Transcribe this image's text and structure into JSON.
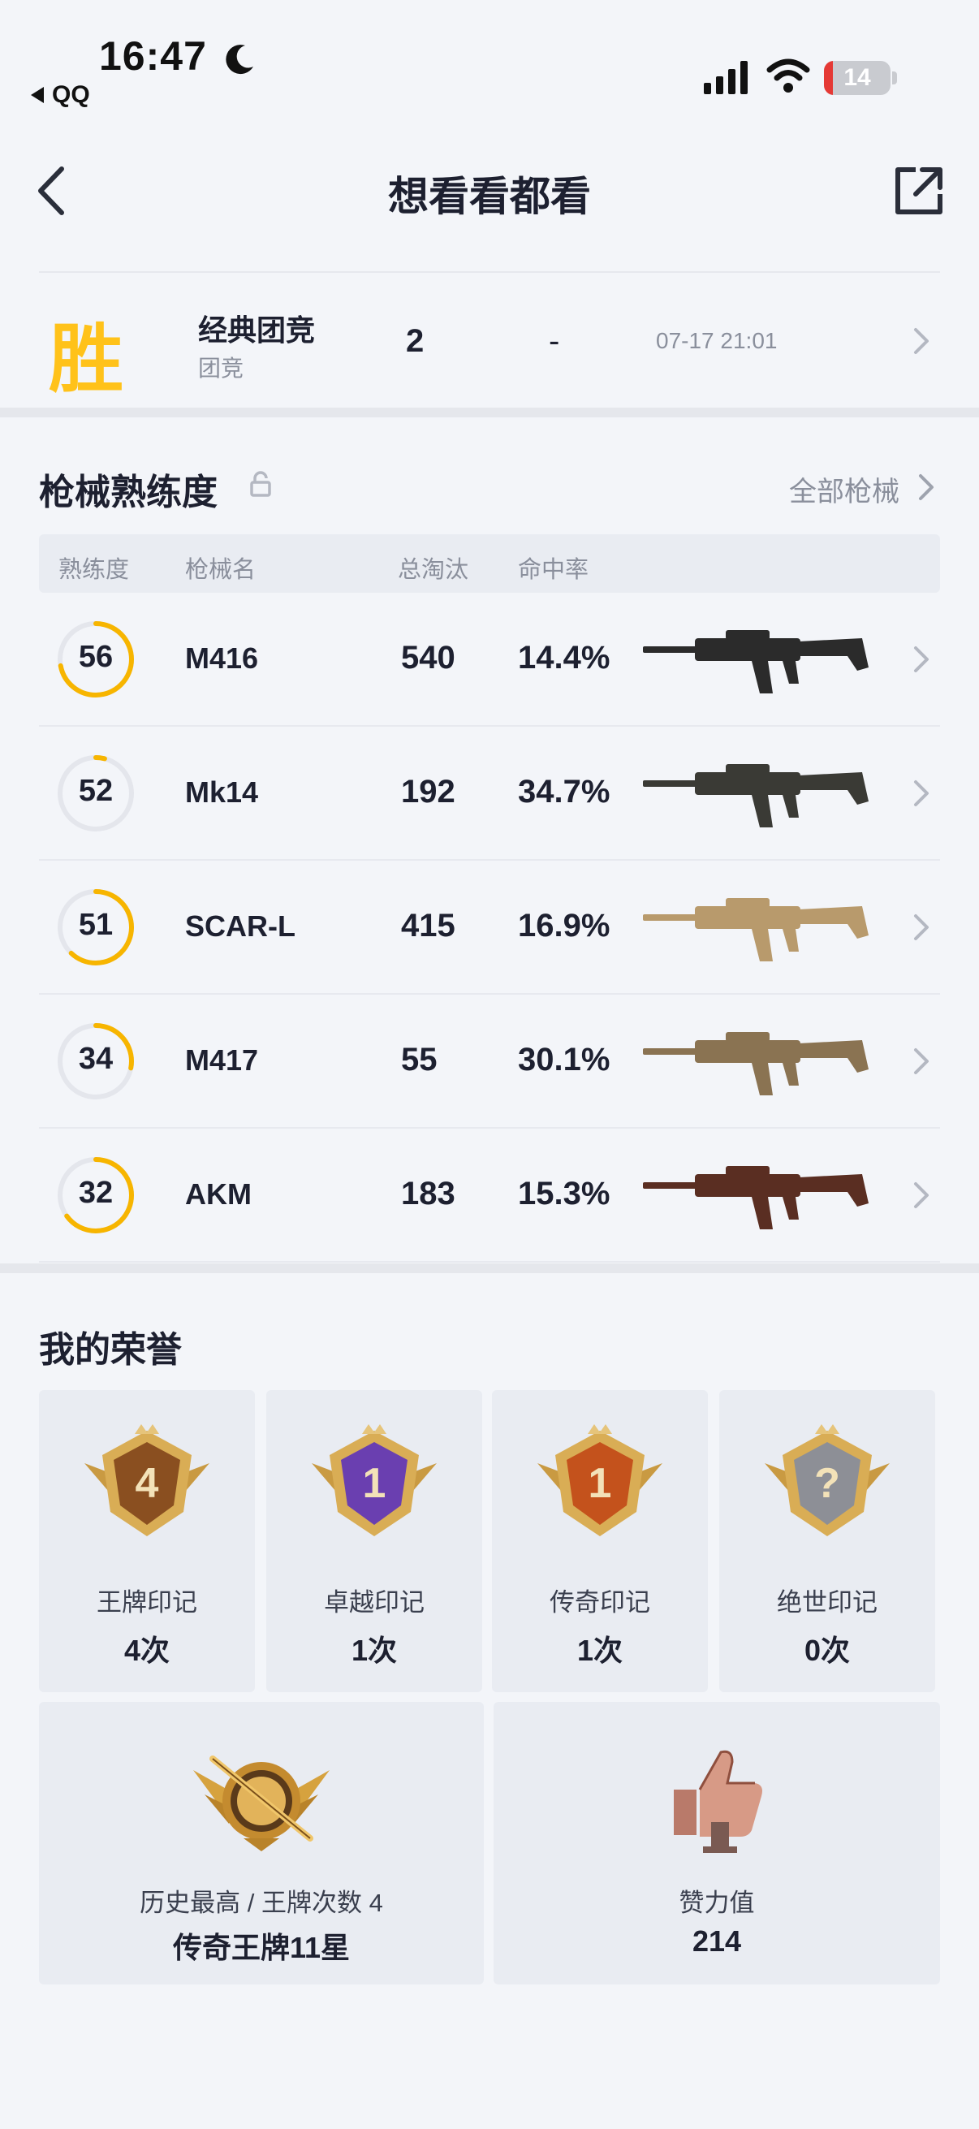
{
  "status_bar": {
    "time": "16:47",
    "back_app": "QQ",
    "battery": "14",
    "battery_level": 0.14,
    "battery_color": "#e53935"
  },
  "nav": {
    "title": "想看看都看",
    "back_icon": "chevron-left-icon",
    "share_icon": "share-icon"
  },
  "match": {
    "result": "胜",
    "mode": "经典团竞",
    "mode_type": "团竞",
    "rank": "2",
    "kills": "-",
    "time": "07-17 21:01"
  },
  "weapons": {
    "title": "枪械熟练度",
    "all_label": "全部枪械",
    "headers": {
      "mastery": "熟练度",
      "name": "枪械名",
      "eliminations": "总淘汰",
      "accuracy": "命中率"
    },
    "rows": [
      {
        "mastery": "56",
        "progress": 0.72,
        "name": "M416",
        "eliminations": "540",
        "accuracy": "14.4%",
        "gun_color": "#2b2b2b"
      },
      {
        "mastery": "52",
        "progress": 0.04,
        "name": "Mk14",
        "eliminations": "192",
        "accuracy": "34.7%",
        "gun_color": "#3a3a35"
      },
      {
        "mastery": "51",
        "progress": 0.62,
        "name": "SCAR-L",
        "eliminations": "415",
        "accuracy": "16.9%",
        "gun_color": "#b89a6c"
      },
      {
        "mastery": "34",
        "progress": 0.28,
        "name": "M417",
        "eliminations": "55",
        "accuracy": "30.1%",
        "gun_color": "#8a7352"
      },
      {
        "mastery": "32",
        "progress": 0.65,
        "name": "AKM",
        "eliminations": "183",
        "accuracy": "15.3%",
        "gun_color": "#5a2e22"
      }
    ]
  },
  "honors": {
    "title": "我的荣誉",
    "badges": [
      {
        "label": "王牌印记",
        "value": "4次",
        "badge_text": "4",
        "color": "#8a4f20",
        "icon": "ace-badge-icon"
      },
      {
        "label": "卓越印记",
        "value": "1次",
        "badge_text": "1",
        "color": "#6a3fb0",
        "icon": "excellence-badge-icon"
      },
      {
        "label": "传奇印记",
        "value": "1次",
        "badge_text": "1",
        "color": "#c4521c",
        "icon": "legend-badge-icon"
      },
      {
        "label": "绝世印记",
        "value": "0次",
        "badge_text": "?",
        "color": "#8d8f96",
        "icon": "peerless-badge-icon"
      }
    ],
    "summary": [
      {
        "label": "历史最高 / 王牌次数 4",
        "value": "传奇王牌11星",
        "icon": "rank-emblem-icon"
      },
      {
        "label": "赞力值",
        "value": "214",
        "icon": "thumbs-up-icon"
      }
    ]
  },
  "colors": {
    "accent_yellow": "#f7b500",
    "win_yellow": "#ffc21a",
    "muted_text": "#8a8f9c"
  }
}
